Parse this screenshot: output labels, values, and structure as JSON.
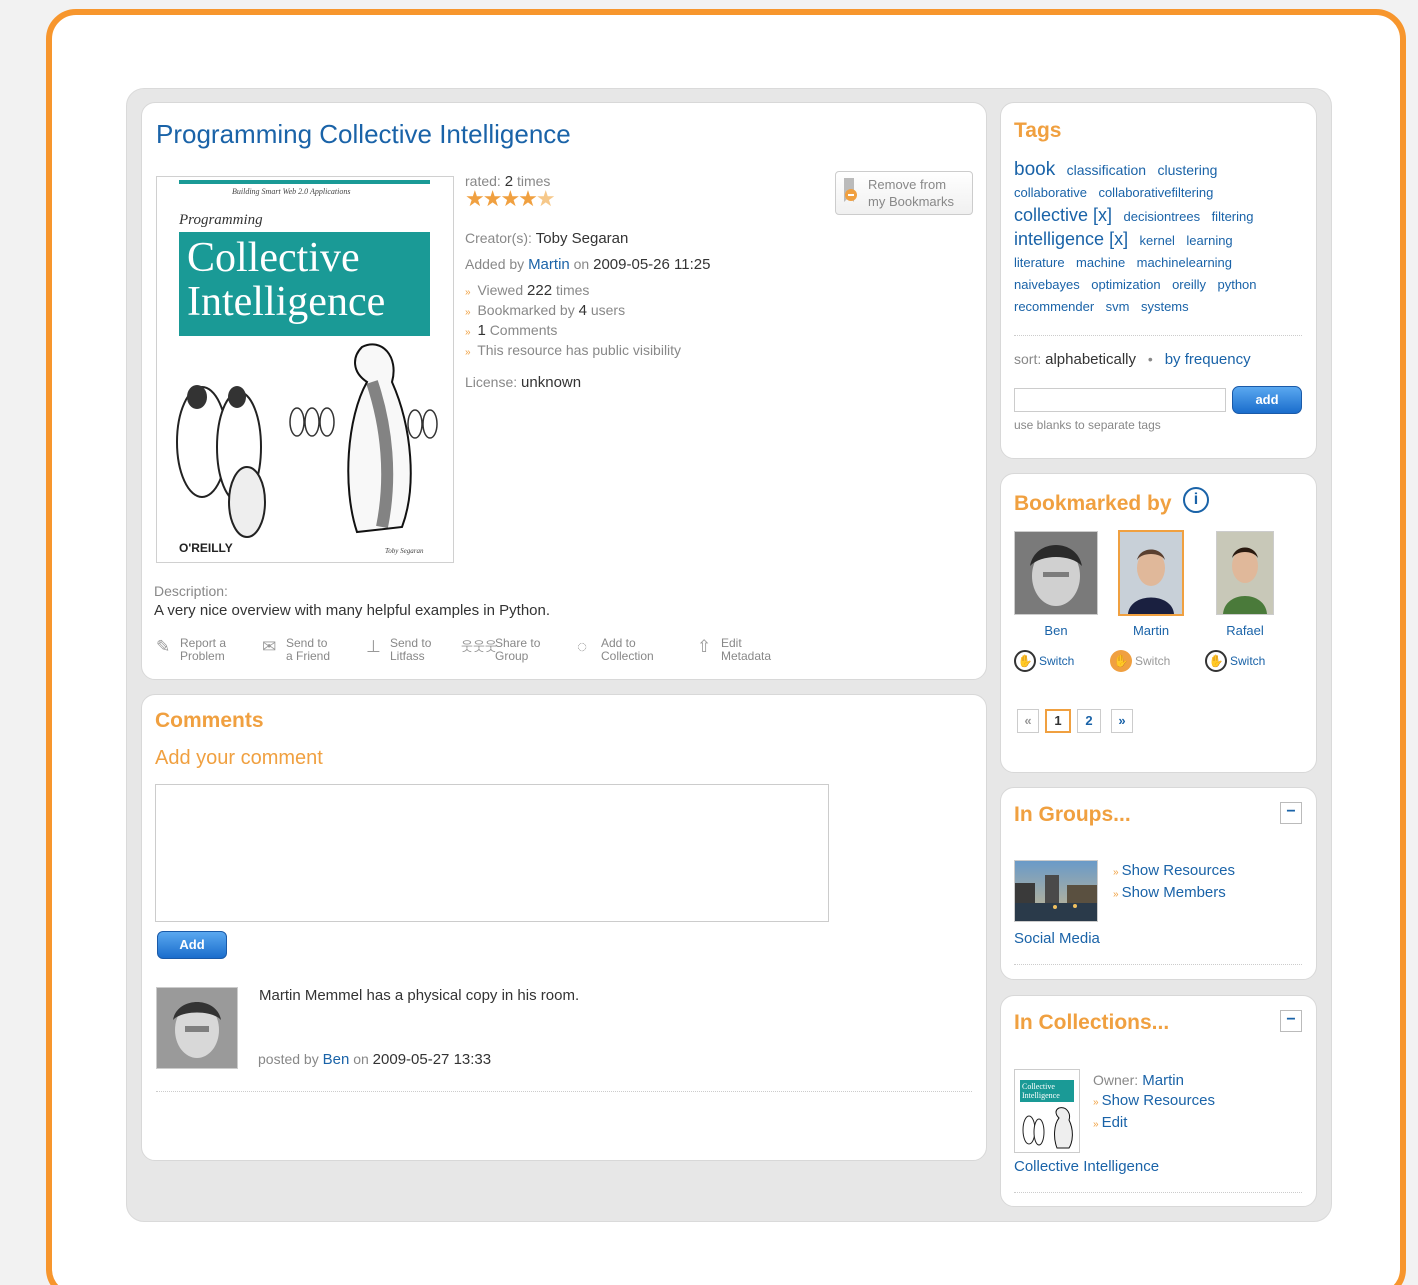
{
  "resource": {
    "title": "Programming Collective Intelligence",
    "cover": {
      "series_line": "Building Smart Web 2.0 Applications",
      "prog": "Programming",
      "line1": "Collective",
      "line2": "Intelligence",
      "publisher": "O'REILLY",
      "author": "Toby Segaran"
    },
    "rated_label": "rated:",
    "rated_value": "2",
    "rated_unit": "times",
    "rating": 4.5,
    "creators_label": "Creator(s):",
    "creators_value": "Toby Segaran",
    "added_by_label": "Added by",
    "added_by_user": "Martin",
    "added_on_label": "on",
    "added_on": "2009-05-26 11:25",
    "viewed_label": "Viewed",
    "viewed_value": "222",
    "viewed_unit": "times",
    "bookmarked_label": "Bookmarked by",
    "bookmarked_value": "4",
    "bookmarked_unit": "users",
    "comments_value": "1",
    "comments_label": "Comments",
    "visibility": "This resource has public visibility",
    "license_label": "License:",
    "license_value": "unknown",
    "remove_line1": "Remove from",
    "remove_line2": "my Bookmarks",
    "description_label": "Description:",
    "description": "A very nice overview with many helpful examples in Python.",
    "actions": [
      {
        "l1": "Report a",
        "l2": "Problem"
      },
      {
        "l1": "Send to",
        "l2": "a Friend"
      },
      {
        "l1": "Send to",
        "l2": "Litfass"
      },
      {
        "l1": "Share to",
        "l2": "Group"
      },
      {
        "l1": "Add to",
        "l2": "Collection"
      },
      {
        "l1": "Edit",
        "l2": "Metadata"
      }
    ]
  },
  "comments": {
    "title": "Comments",
    "add_your_comment": "Add your comment",
    "add_button": "Add",
    "items": [
      {
        "text": "Martin Memmel has a physical copy in his room.",
        "posted_by_label": "posted by",
        "author": "Ben",
        "on_label": "on",
        "date": "2009-05-27 13:33"
      }
    ]
  },
  "tags": {
    "title": "Tags",
    "list": [
      {
        "t": "book",
        "s": 19
      },
      {
        "t": "classification",
        "s": 14
      },
      {
        "t": "clustering",
        "s": 14
      },
      {
        "t": "collaborative",
        "s": 13
      },
      {
        "t": "collaborativefiltering",
        "s": 13
      },
      {
        "t": "collective [x]",
        "s": 18
      },
      {
        "t": "decisiontrees",
        "s": 13
      },
      {
        "t": "filtering",
        "s": 13
      },
      {
        "t": "intelligence [x]",
        "s": 18
      },
      {
        "t": "kernel",
        "s": 13
      },
      {
        "t": "learning",
        "s": 13
      },
      {
        "t": "literature",
        "s": 13
      },
      {
        "t": "machine",
        "s": 13
      },
      {
        "t": "machinelearning",
        "s": 13
      },
      {
        "t": "naivebayes",
        "s": 13
      },
      {
        "t": "optimization",
        "s": 13
      },
      {
        "t": "oreilly",
        "s": 13
      },
      {
        "t": "python",
        "s": 13
      },
      {
        "t": "recommender",
        "s": 13
      },
      {
        "t": "svm",
        "s": 13
      },
      {
        "t": "systems",
        "s": 13
      }
    ],
    "sort_label": "sort:",
    "sort_active": "alphabetically",
    "sort_other": "by frequency",
    "add_button": "add",
    "input_value": "",
    "hint": "use blanks to separate tags"
  },
  "bookmarked_by": {
    "title": "Bookmarked by",
    "users": [
      {
        "name": "Ben",
        "switch": "Switch"
      },
      {
        "name": "Martin",
        "switch": "Switch"
      },
      {
        "name": "Rafael",
        "switch": "Switch"
      }
    ],
    "pager": {
      "first": "«",
      "pages": [
        "1",
        "2"
      ],
      "next": "»",
      "current": "1"
    }
  },
  "groups": {
    "title": "In Groups...",
    "show_resources": "Show Resources",
    "show_members": "Show Members",
    "group_name": "Social Media"
  },
  "collections": {
    "title": "In Collections...",
    "owner_label": "Owner:",
    "owner": "Martin",
    "show_resources": "Show Resources",
    "edit": "Edit",
    "collection_name": "Collective Intelligence",
    "thumb_line1": "Collective",
    "thumb_line2": "Intelligence"
  },
  "colors": {
    "accent_orange": "#f7962d",
    "link_blue": "#1a63a8",
    "heading_orange": "#f0a040"
  }
}
